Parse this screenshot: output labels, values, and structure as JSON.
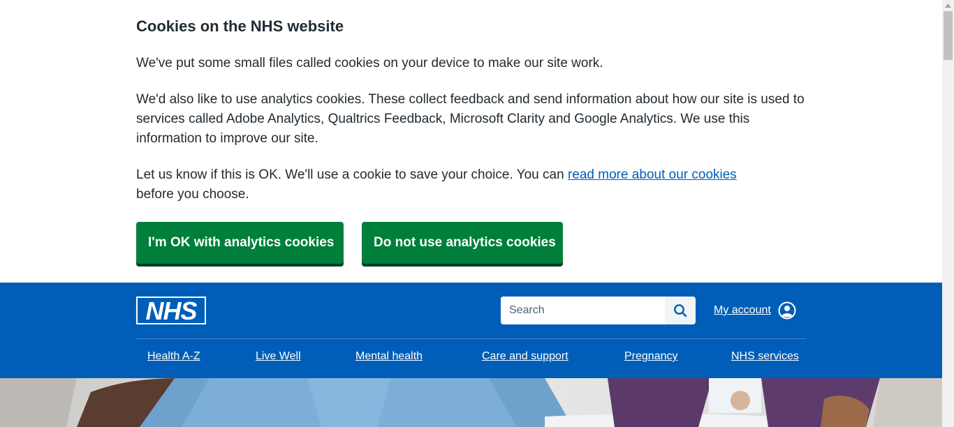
{
  "cookie_banner": {
    "title": "Cookies on the NHS website",
    "para1": "We've put some small files called cookies on your device to make our site work.",
    "para2": "We'd also like to use analytics cookies. These collect feedback and send information about how our site is used to services called Adobe Analytics, Qualtrics Feedback, Microsoft Clarity and Google Analytics. We use this information to improve our site.",
    "para3_before": "Let us know if this is OK. We'll use a cookie to save your choice. You can ",
    "para3_link": "read more about our cookies",
    "para3_after": " before you choose.",
    "accept_label": "I'm OK with analytics cookies",
    "reject_label": "Do not use analytics cookies"
  },
  "header": {
    "logo_text": "NHS",
    "search": {
      "placeholder": "Search",
      "value": "",
      "icon": "search-icon"
    },
    "account_label": "My account",
    "account_icon": "user-circle-icon",
    "nav": [
      {
        "label": "Health A-Z"
      },
      {
        "label": "Live Well"
      },
      {
        "label": "Mental health"
      },
      {
        "label": "Care and support"
      },
      {
        "label": "Pregnancy"
      },
      {
        "label": "NHS services"
      }
    ]
  },
  "colors": {
    "nhs_blue": "#005eb8",
    "button_green": "#007f3b",
    "text": "#212b32",
    "link": "#005eb8"
  }
}
